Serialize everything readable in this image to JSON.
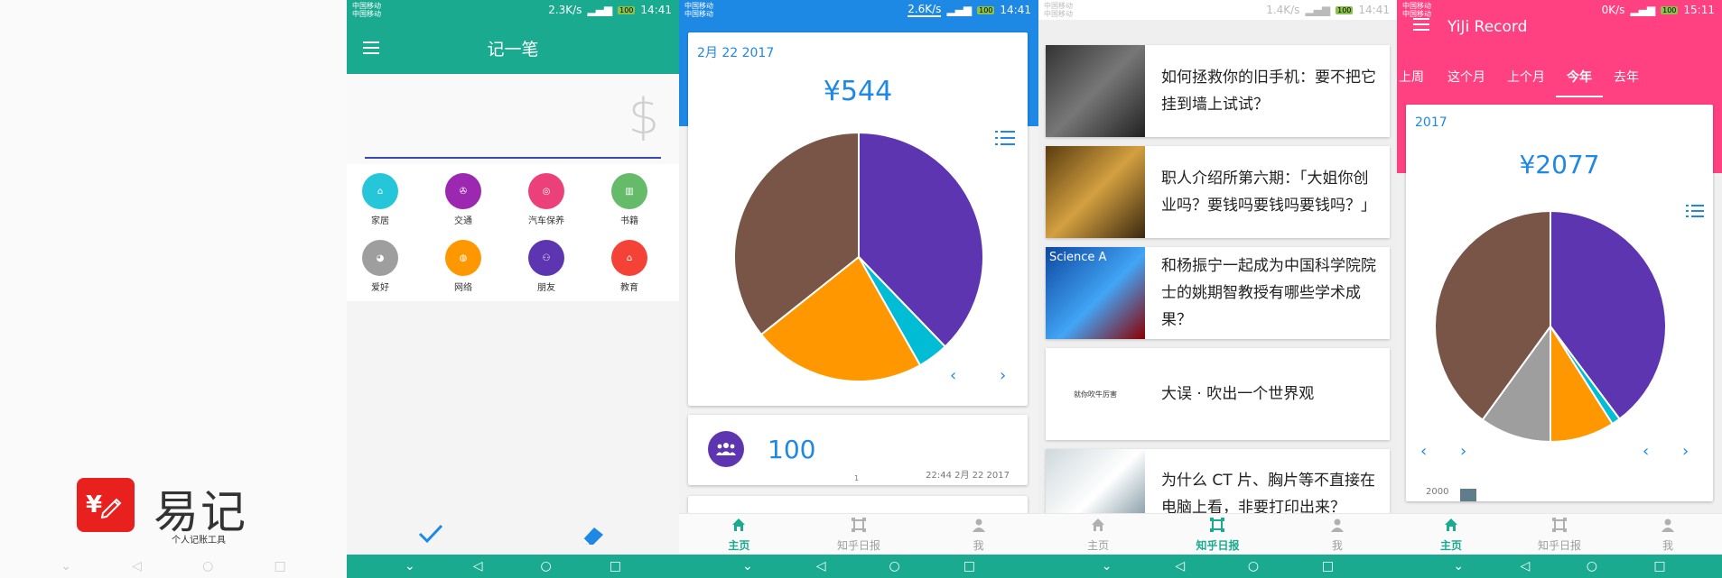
{
  "splash": {
    "app_name": "易记",
    "tagline": "个人记账工具",
    "logo_text": "¥",
    "brand_color": "#e8201e"
  },
  "screen_record": {
    "status": {
      "carrier1": "中国移动",
      "carrier2": "中国移动",
      "speed": "2.3K/s",
      "time": "14:41"
    },
    "title": "记一笔",
    "menu_icon": "hamburger-icon",
    "currency_symbol": "$",
    "categories": [
      {
        "label": "家居",
        "color": "#26c6da",
        "icon": "home-icon"
      },
      {
        "label": "交通",
        "color": "#9c27b0",
        "icon": "transport-icon"
      },
      {
        "label": "汽车保养",
        "color": "#ec407a",
        "icon": "steering-wheel-icon"
      },
      {
        "label": "书籍",
        "color": "#66bb6a",
        "icon": "books-icon"
      },
      {
        "label": "爱好",
        "color": "#9e9e9e",
        "icon": "palette-icon"
      },
      {
        "label": "网络",
        "color": "#ff9800",
        "icon": "globe-icon"
      },
      {
        "label": "朋友",
        "color": "#5e35b1",
        "icon": "people-icon"
      },
      {
        "label": "教育",
        "color": "#f44336",
        "icon": "graduation-cap-icon"
      }
    ],
    "confirm_icon": "check-icon",
    "erase_icon": "eraser-icon",
    "accent_color": "#1aaa8f"
  },
  "screen_home": {
    "status": {
      "carrier1": "中国移动",
      "carrier2": "中国移动",
      "speed": "2.6K/s",
      "time": "14:41"
    },
    "date": "2月 22 2017",
    "total": "¥544",
    "pie": [
      {
        "value": 0.378,
        "color": "#5e35b1"
      },
      {
        "value": 0.04,
        "color": "#00bcd4"
      },
      {
        "value": 0.225,
        "color": "#ff9800"
      },
      {
        "value": 0.357,
        "color": "#795548"
      }
    ],
    "record": {
      "amount": "100",
      "time": "22:44 2月 22 2017",
      "index": "1",
      "icon": "people-icon"
    },
    "tabs": [
      {
        "label": "主页",
        "icon": "home-icon",
        "active": true
      },
      {
        "label": "知乎日报",
        "icon": "frame-icon",
        "active": false
      },
      {
        "label": "我",
        "icon": "person-icon",
        "active": false
      }
    ]
  },
  "screen_zhihu": {
    "status": {
      "carrier1": "中国移动",
      "carrier2": "中国移动",
      "speed": "1.4K/s",
      "time": "14:41"
    },
    "articles": [
      {
        "title": "如何拯救你的旧手机：要不把它挂到墙上试试？"
      },
      {
        "title": "职人介绍所第六期：「大姐你创业吗？要钱吗要钱吗要钱吗？」"
      },
      {
        "title": "和杨振宁一起成为中国科学院院士的姚期智教授有哪些学术成果？",
        "thumb_text": "Science A"
      },
      {
        "title": "大误 · 吹出一个世界观",
        "thumb_text": "就你吹牛厉害"
      },
      {
        "title": "为什么 CT 片、胸片等不直接在电脑上看，非要打印出来？"
      }
    ],
    "tabs": [
      {
        "label": "主页",
        "icon": "home-icon",
        "active": false
      },
      {
        "label": "知乎日报",
        "icon": "frame-icon",
        "active": true
      },
      {
        "label": "我",
        "icon": "person-icon",
        "active": false
      }
    ]
  },
  "screen_stats": {
    "status": {
      "carrier1": "中国移动",
      "carrier2": "中国移动",
      "speed": "0K/s",
      "time": "15:11"
    },
    "title": "YiJi Record",
    "periods": [
      "上周",
      "这个月",
      "上个月",
      "今年",
      "去年"
    ],
    "active_period": "今年",
    "year": "2017",
    "total": "¥2077",
    "pie": [
      {
        "value": 0.398,
        "color": "#5e35b1"
      },
      {
        "value": 0.012,
        "color": "#00bcd4"
      },
      {
        "value": 0.09,
        "color": "#ff9800"
      },
      {
        "value": 0.1,
        "color": "#9e9e9e"
      },
      {
        "value": 0.4,
        "color": "#795548"
      }
    ],
    "bar_axis_label": "2000",
    "accent_color": "#ff4081",
    "tabs": [
      {
        "label": "主页",
        "icon": "home-icon",
        "active": true
      },
      {
        "label": "知乎日报",
        "icon": "frame-icon",
        "active": false
      },
      {
        "label": "我",
        "icon": "person-icon",
        "active": false
      }
    ]
  }
}
